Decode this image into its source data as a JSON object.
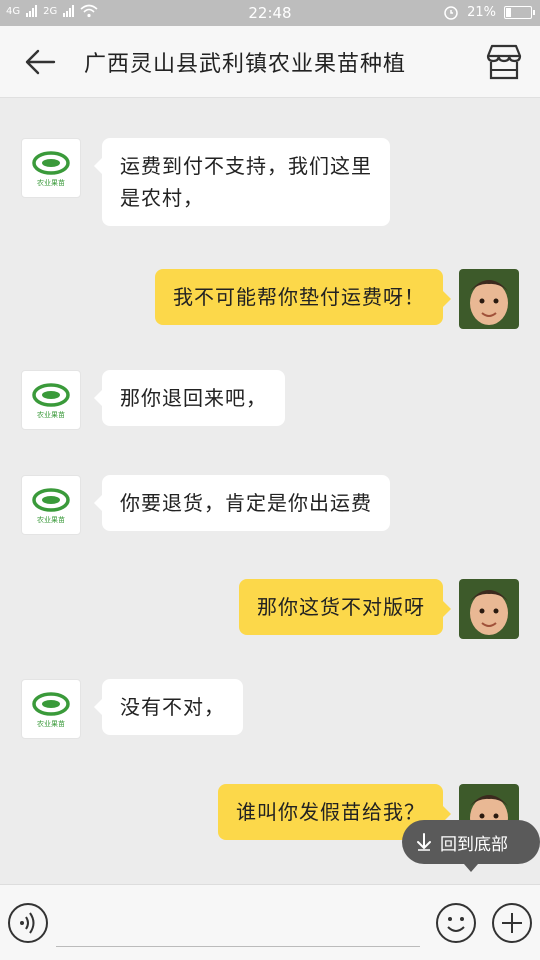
{
  "status_bar": {
    "network_1": "4G",
    "network_2": "2G",
    "time": "22:48",
    "battery": "21%",
    "battery_level": 0.21
  },
  "header": {
    "title": "广西灵山县武利镇农业果苗种植",
    "back_icon": "arrow-left-icon",
    "shop_icon": "store-icon"
  },
  "shop_avatar_text": "农业果苗",
  "messages": [
    {
      "side": "in",
      "text": "运费到付不支持，我们这里\n是农村，"
    },
    {
      "side": "out",
      "text": "我不可能帮你垫付运费呀！"
    },
    {
      "side": "in",
      "text": "那你退回来吧，"
    },
    {
      "side": "in",
      "text": "你要退货，肯定是你出运费"
    },
    {
      "side": "out",
      "text": "那你这货不对版呀"
    },
    {
      "side": "in",
      "text": "没有不对，"
    },
    {
      "side": "out",
      "text": "谁叫你发假苗给我？"
    }
  ],
  "back_to_bottom": {
    "label": "回到底部",
    "icon": "arrow-down-icon"
  },
  "input_bar": {
    "voice_icon": "voice-icon",
    "emoji_icon": "emoji-icon",
    "plus_icon": "plus-icon"
  }
}
